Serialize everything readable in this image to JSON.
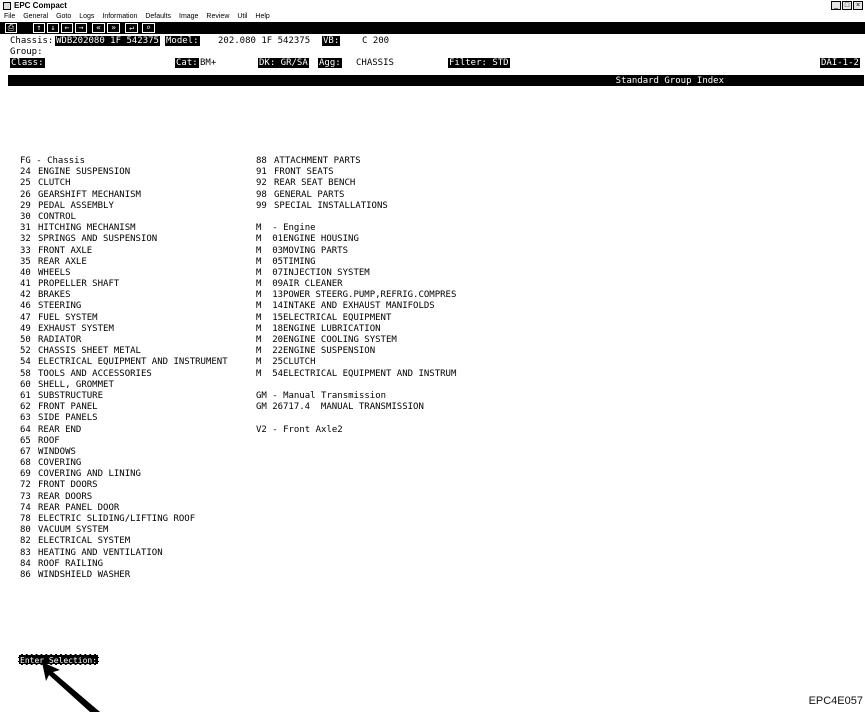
{
  "window": {
    "title": "EPC Compact",
    "controls": [
      "_",
      "□",
      "×"
    ]
  },
  "menu": [
    "File",
    "General",
    "Goto",
    "Logs",
    "Information",
    "Defaults",
    "Image",
    "Review",
    "Util",
    "Help"
  ],
  "toolbar": [
    "⎙",
    "↑",
    "↓",
    "←",
    "→",
    "«",
    "»",
    "↵",
    "⌕"
  ],
  "header": {
    "chassis_label": "Chassis:",
    "chassis_value": "WDB202080 1F 542375",
    "model_label": "Model:",
    "model_value": "202.080 1F 542375",
    "vb_label": "VB:",
    "vb_value": "C 200",
    "group_label": "Group:",
    "class_label": "Class:",
    "cat_label": "Cat:",
    "cat_value": "BM+",
    "dk_label": "DK: GR/SA",
    "agg_label": "Agg:",
    "agg_value": "CHASSIS",
    "filter_label": "Filter: STD",
    "dai_label": "DAI-1-2"
  },
  "banner_title": "Standard Group Index",
  "left_list": {
    "heading": "FG - Chassis",
    "items": [
      {
        "code": "24",
        "label": "ENGINE SUSPENSION"
      },
      {
        "code": "25",
        "label": "CLUTCH"
      },
      {
        "code": "26",
        "label": "GEARSHIFT MECHANISM"
      },
      {
        "code": "29",
        "label": "PEDAL ASSEMBLY"
      },
      {
        "code": "30",
        "label": "CONTROL"
      },
      {
        "code": "31",
        "label": "HITCHING MECHANISM"
      },
      {
        "code": "32",
        "label": "SPRINGS AND SUSPENSION"
      },
      {
        "code": "33",
        "label": "FRONT AXLE"
      },
      {
        "code": "35",
        "label": "REAR AXLE"
      },
      {
        "code": "40",
        "label": "WHEELS"
      },
      {
        "code": "41",
        "label": "PROPELLER SHAFT"
      },
      {
        "code": "42",
        "label": "BRAKES"
      },
      {
        "code": "46",
        "label": "STEERING"
      },
      {
        "code": "47",
        "label": "FUEL SYSTEM"
      },
      {
        "code": "49",
        "label": "EXHAUST SYSTEM"
      },
      {
        "code": "50",
        "label": "RADIATOR"
      },
      {
        "code": "52",
        "label": "CHASSIS SHEET METAL"
      },
      {
        "code": "54",
        "label": "ELECTRICAL EQUIPMENT AND INSTRUMENT"
      },
      {
        "code": "58",
        "label": "TOOLS AND ACCESSORIES"
      },
      {
        "code": "60",
        "label": "SHELL, GROMMET"
      },
      {
        "code": "61",
        "label": "SUBSTRUCTURE"
      },
      {
        "code": "62",
        "label": "FRONT PANEL"
      },
      {
        "code": "63",
        "label": "SIDE PANELS"
      },
      {
        "code": "64",
        "label": "REAR END"
      },
      {
        "code": "65",
        "label": "ROOF"
      },
      {
        "code": "67",
        "label": "WINDOWS"
      },
      {
        "code": "68",
        "label": "COVERING"
      },
      {
        "code": "69",
        "label": "COVERING AND LINING"
      },
      {
        "code": "72",
        "label": "FRONT DOORS"
      },
      {
        "code": "73",
        "label": "REAR DOORS"
      },
      {
        "code": "74",
        "label": "REAR PANEL DOOR"
      },
      {
        "code": "78",
        "label": "ELECTRIC SLIDING/LIFTING ROOF"
      },
      {
        "code": "80",
        "label": "VACUUM SYSTEM"
      },
      {
        "code": "82",
        "label": "ELECTRICAL SYSTEM"
      },
      {
        "code": "83",
        "label": "HEATING AND VENTILATION"
      },
      {
        "code": "84",
        "label": "ROOF RAILING"
      },
      {
        "code": "86",
        "label": "WINDSHIELD WASHER"
      }
    ]
  },
  "right_list": {
    "fg_items": [
      {
        "code": "88",
        "label": "ATTACHMENT PARTS"
      },
      {
        "code": "91",
        "label": "FRONT SEATS"
      },
      {
        "code": "92",
        "label": "REAR SEAT BENCH"
      },
      {
        "code": "98",
        "label": "GENERAL PARTS"
      },
      {
        "code": "99",
        "label": "SPECIAL INSTALLATIONS"
      }
    ],
    "engine_heading": "M  - Engine",
    "engine_items": [
      {
        "code": "M  01",
        "label": "ENGINE HOUSING"
      },
      {
        "code": "M  03",
        "label": "MOVING PARTS"
      },
      {
        "code": "M  05",
        "label": "TIMING"
      },
      {
        "code": "M  07",
        "label": "INJECTION SYSTEM"
      },
      {
        "code": "M  09",
        "label": "AIR CLEANER"
      },
      {
        "code": "M  13",
        "label": "POWER STEERG.PUMP,REFRIG.COMPRES"
      },
      {
        "code": "M  14",
        "label": "INTAKE AND EXHAUST MANIFOLDS"
      },
      {
        "code": "M  15",
        "label": "ELECTRICAL EQUIPMENT"
      },
      {
        "code": "M  18",
        "label": "ENGINE LUBRICATION"
      },
      {
        "code": "M  20",
        "label": "ENGINE COOLING SYSTEM"
      },
      {
        "code": "M  22",
        "label": "ENGINE SUSPENSION"
      },
      {
        "code": "M  25",
        "label": "CLUTCH"
      },
      {
        "code": "M  54",
        "label": "ELECTRICAL EQUIPMENT AND INSTRUM"
      }
    ],
    "gm_heading": "GM - Manual Transmission",
    "gm_items": [
      {
        "code": "GM 26",
        "label": "717.4  MANUAL TRANSMISSION"
      }
    ],
    "v2_heading": "V2 - Front Axle2"
  },
  "prompt": "Enter Selection:",
  "figure_code": "EPC4E057"
}
